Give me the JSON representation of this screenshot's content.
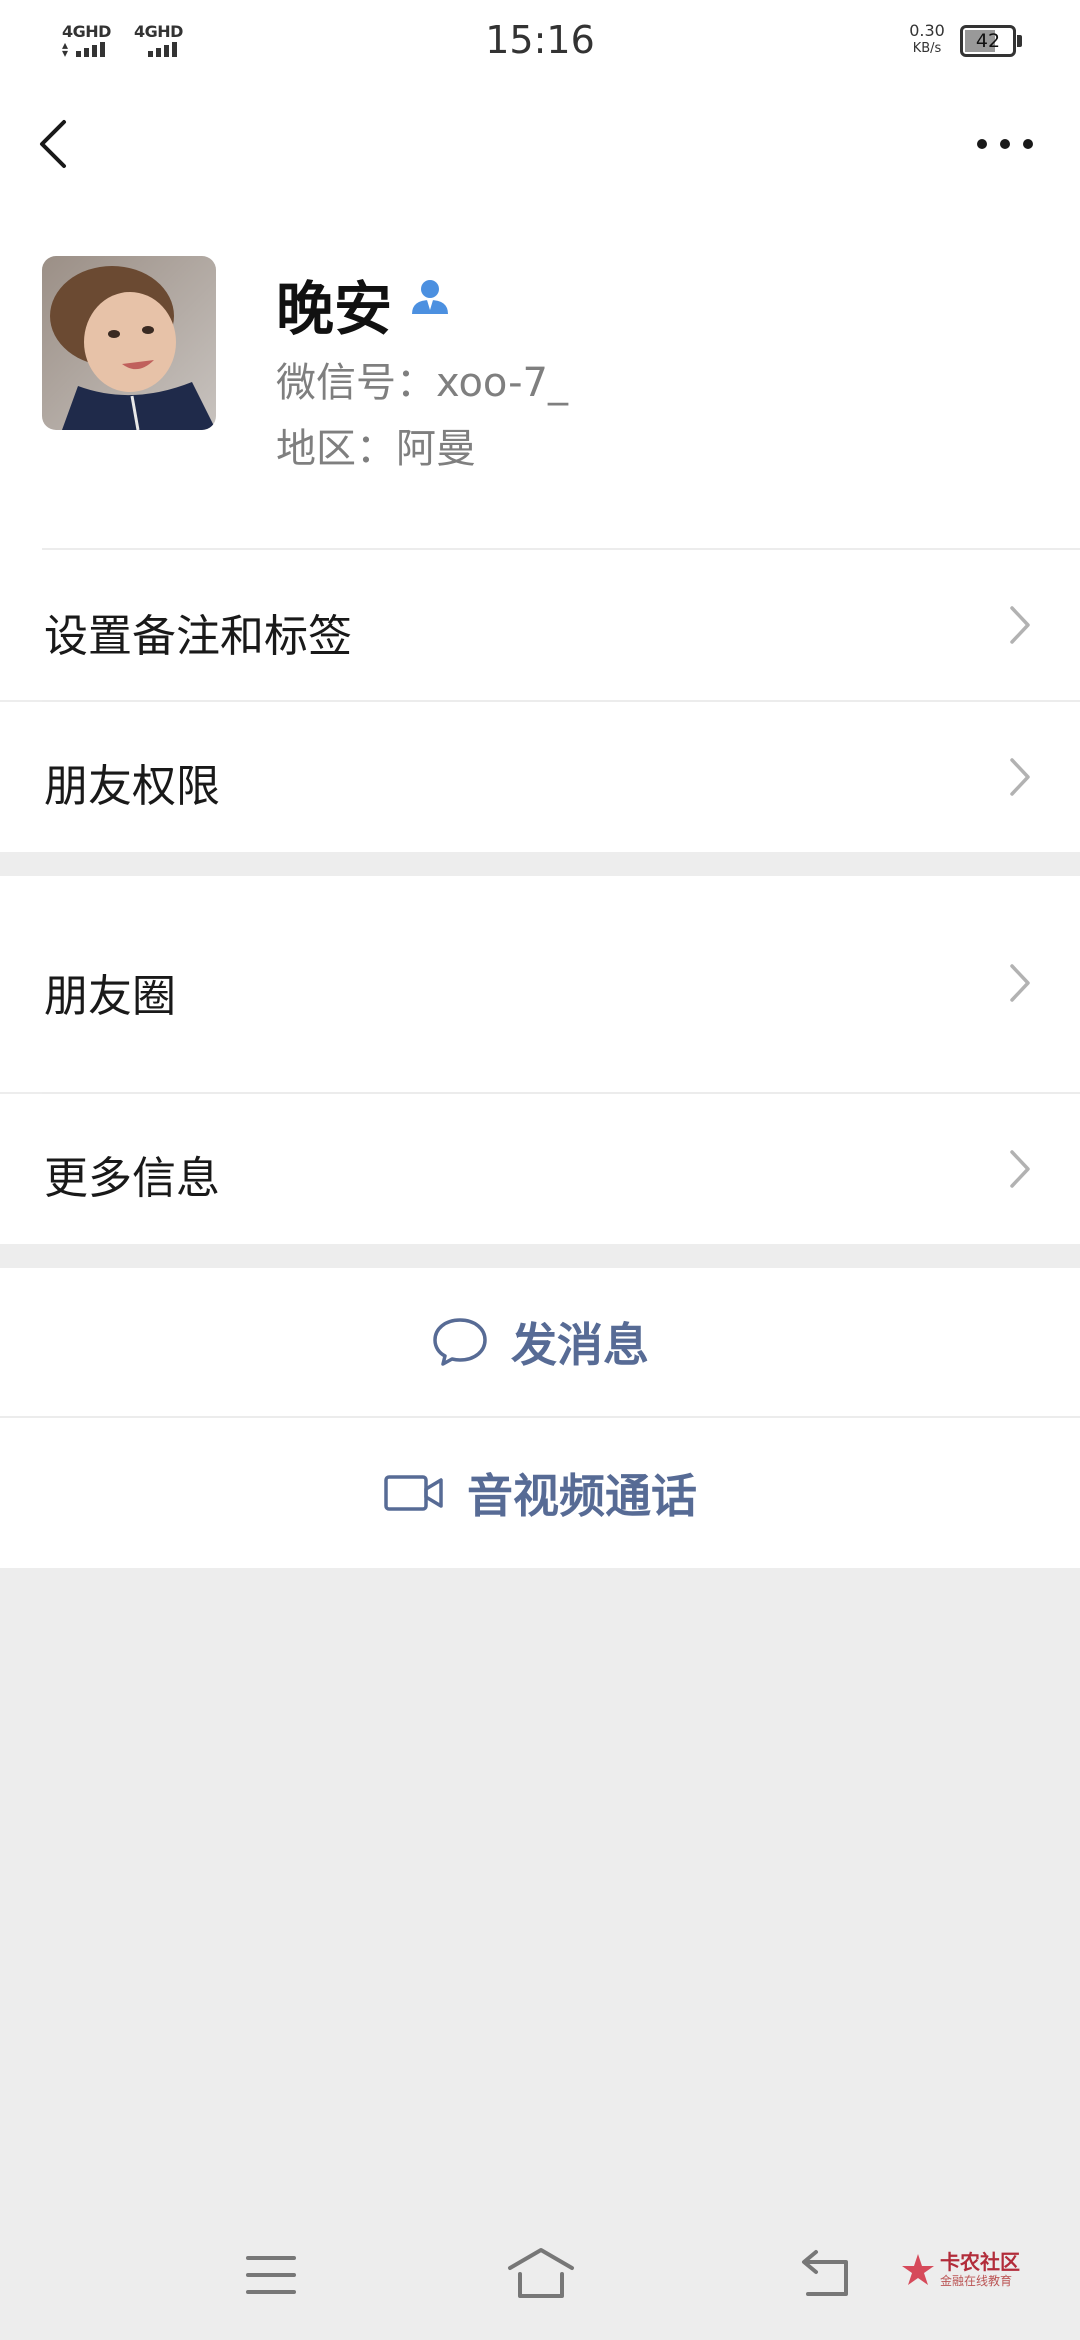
{
  "status_bar": {
    "network_1": "4GHD",
    "network_2": "4GHD",
    "time": "15:16",
    "speed_value": "0.30",
    "speed_unit": "KB/s",
    "battery_level": "42"
  },
  "nav": {
    "back_icon": "chevron-left-icon",
    "more_icon": "more-dots-icon"
  },
  "profile": {
    "name": "晚安",
    "wechat_id_line": "微信号：xoo-7_",
    "region_line": "地区：阿曼"
  },
  "menu": {
    "remark_tags": "设置备注和标签",
    "friend_permissions": "朋友权限",
    "moments": "朋友圈",
    "more_info": "更多信息"
  },
  "actions": {
    "send_message": "发消息",
    "av_call": "音视频通话"
  },
  "watermark": {
    "title": "卡农社区",
    "subtitle": "金融在线教育"
  },
  "colors": {
    "action_blue": "#576b95",
    "verify_blue": "#4c90e0",
    "background_gray": "#ededed"
  }
}
